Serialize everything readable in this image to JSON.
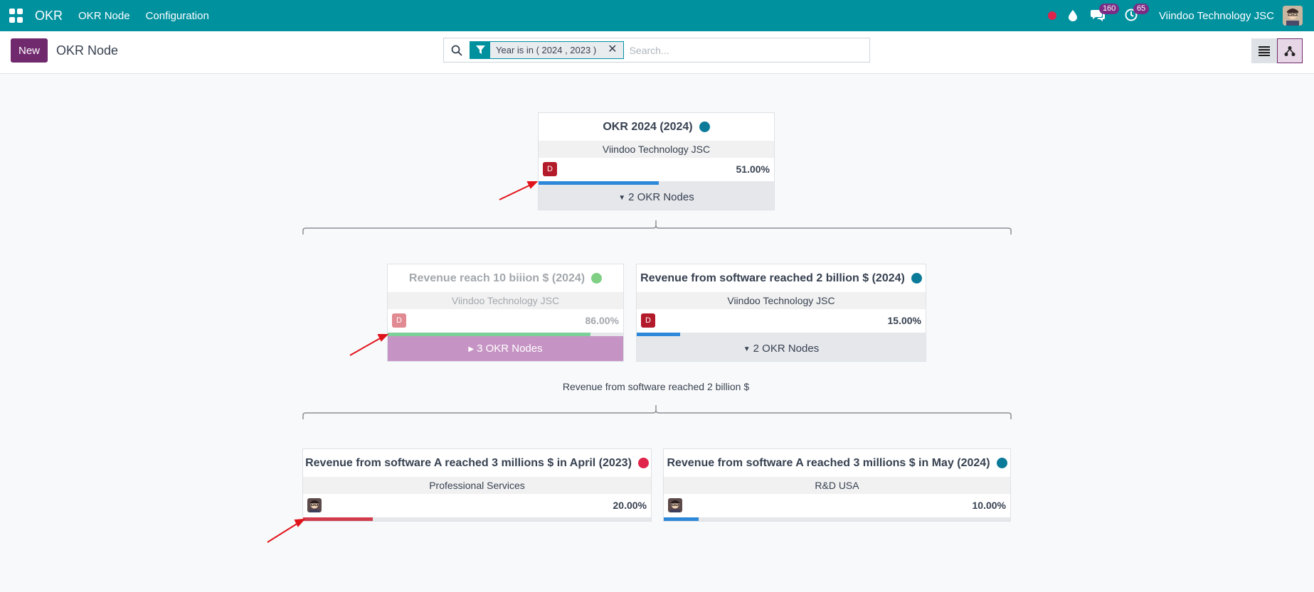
{
  "navbar": {
    "brand": "OKR",
    "links": [
      "OKR Node",
      "Configuration"
    ],
    "chat_badge": "160",
    "activity_badge": "65",
    "company": "Viindoo Technology JSC",
    "colors": {
      "bg": "#00919f",
      "badge": "#7b2d85",
      "record": "#e0234a"
    }
  },
  "control": {
    "new_label": "New",
    "title": "OKR Node",
    "facet": "Year is in ( 2024 , 2023 )",
    "search_placeholder": "Search..."
  },
  "root": {
    "title": "OKR 2024 (2024)",
    "dot_color": "#0c7b99",
    "company": "Viindoo Technology JSC",
    "badge": "D",
    "percent_label": "51.00%",
    "progress": 0.51,
    "bar_color": "#2d88d9",
    "children_label": "2 OKR Nodes"
  },
  "level2": [
    {
      "title": "Revenue reach 10 biiion $ (2024)",
      "dot_color": "#7fcf85",
      "company": "Viindoo Technology JSC",
      "badge": "D",
      "percent_label": "86.00%",
      "progress": 0.86,
      "bar_color": "#7fcf9a",
      "children_label": "3 OKR Nodes"
    },
    {
      "title": "Revenue from software reached 2 billion $ (2024)",
      "dot_color": "#0c7b99",
      "company": "Viindoo Technology JSC",
      "badge": "D",
      "percent_label": "15.00%",
      "progress": 0.15,
      "bar_color": "#2d88d9",
      "children_label": "2 OKR Nodes"
    }
  ],
  "group_label": "Revenue from software reached 2 billion $",
  "level3": [
    {
      "title": "Revenue from software A reached 3 millions $ in April (2023)",
      "dot_color": "#e0234a",
      "company": "Professional Services",
      "percent_label": "20.00%",
      "progress": 0.2,
      "bar_color": "#d13c4d"
    },
    {
      "title": "Revenue from software A reached 3 millions $ in May (2024)",
      "dot_color": "#0c7b99",
      "company": "R&D USA",
      "percent_label": "10.00%",
      "progress": 0.1,
      "bar_color": "#2d88d9"
    }
  ]
}
